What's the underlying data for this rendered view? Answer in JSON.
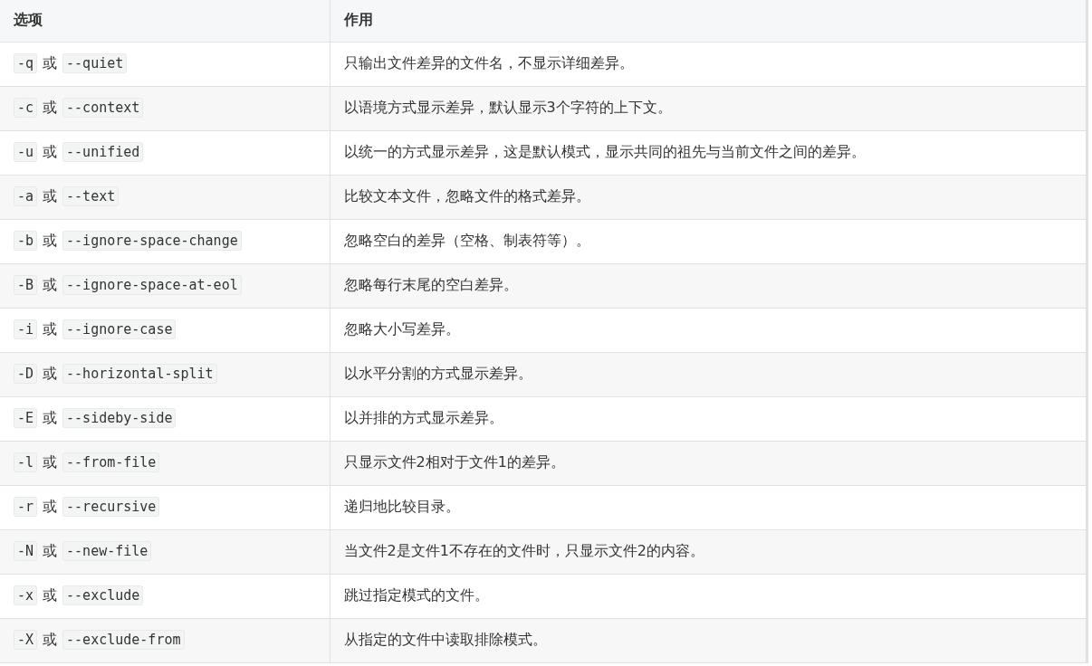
{
  "table": {
    "columns": [
      "选项",
      "作用"
    ],
    "rows": [
      {
        "short": "-q",
        "separator": "或",
        "long": "--quiet",
        "description": "只输出文件差异的文件名，不显示详细差异。"
      },
      {
        "short": "-c",
        "separator": "或",
        "long": "--context",
        "description": "以语境方式显示差异，默认显示3个字符的上下文。"
      },
      {
        "short": "-u",
        "separator": "或",
        "long": "--unified",
        "description": "以统一的方式显示差异，这是默认模式，显示共同的祖先与当前文件之间的差异。"
      },
      {
        "short": "-a",
        "separator": "或",
        "long": "--text",
        "description": "比较文本文件，忽略文件的格式差异。"
      },
      {
        "short": "-b",
        "separator": "或",
        "long": "--ignore-space-change",
        "description": "忽略空白的差异（空格、制表符等）。"
      },
      {
        "short": "-B",
        "separator": "或",
        "long": "--ignore-space-at-eol",
        "description": "忽略每行末尾的空白差异。"
      },
      {
        "short": "-i",
        "separator": "或",
        "long": "--ignore-case",
        "description": "忽略大小写差异。"
      },
      {
        "short": "-D",
        "separator": "或",
        "long": "--horizontal-split",
        "description": "以水平分割的方式显示差异。"
      },
      {
        "short": "-E",
        "separator": "或",
        "long": "--sideby-side",
        "description": "以并排的方式显示差异。"
      },
      {
        "short": "-l",
        "separator": "或",
        "long": "--from-file",
        "description": "只显示文件2相对于文件1的差异。"
      },
      {
        "short": "-r",
        "separator": "或",
        "long": "--recursive",
        "description": "递归地比较目录。"
      },
      {
        "short": "-N",
        "separator": "或",
        "long": "--new-file",
        "description": "当文件2是文件1不存在的文件时，只显示文件2的内容。"
      },
      {
        "short": "-x",
        "separator": "或",
        "long": "--exclude",
        "description": "跳过指定模式的文件。"
      },
      {
        "short": "-X",
        "separator": "或",
        "long": "--exclude-from",
        "description": "从指定的文件中读取排除模式。"
      }
    ]
  }
}
